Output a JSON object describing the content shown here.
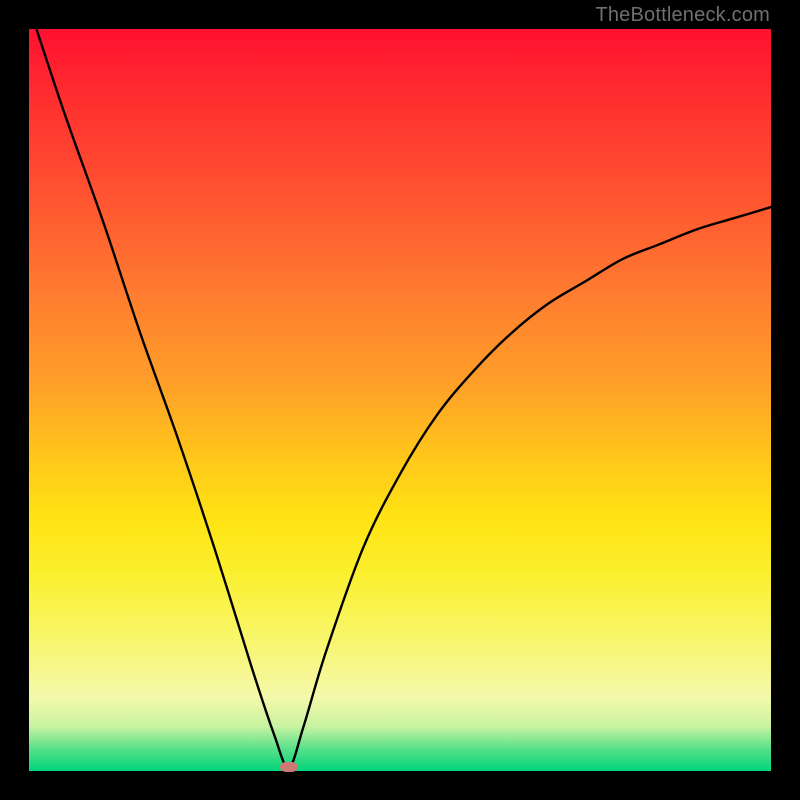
{
  "attribution": "TheBottleneck.com",
  "colors": {
    "gradient_top": "#ff1030",
    "gradient_bottom": "#00d57a",
    "curve": "#000000",
    "marker": "#cd7a77",
    "frame": "#000000"
  },
  "chart_data": {
    "type": "line",
    "title": "",
    "xlabel": "",
    "ylabel": "",
    "xlim": [
      0,
      100
    ],
    "ylim": [
      0,
      100
    ],
    "notes": "Background is a vertical rainbow gradient (red at top through orange/yellow to green at bottom). Single black V-shaped curve with a sharp minimum near x≈35 reaching y≈0, rising steeply to y≈100 on the left edge and asymptotically toward y≈76 on the right edge. A small reddish oval marker sits at the curve's minimum.",
    "series": [
      {
        "name": "curve",
        "x": [
          1,
          5,
          10,
          15,
          20,
          25,
          30,
          33,
          35,
          37,
          40,
          45,
          50,
          55,
          60,
          65,
          70,
          75,
          80,
          85,
          90,
          95,
          100
        ],
        "y": [
          100,
          88,
          74,
          59,
          45,
          30,
          14,
          5,
          0.5,
          6,
          16,
          30,
          40,
          48,
          54,
          59,
          63,
          66,
          69,
          71,
          73,
          74.5,
          76
        ]
      }
    ],
    "marker": {
      "x": 35,
      "y": 0.5
    }
  }
}
